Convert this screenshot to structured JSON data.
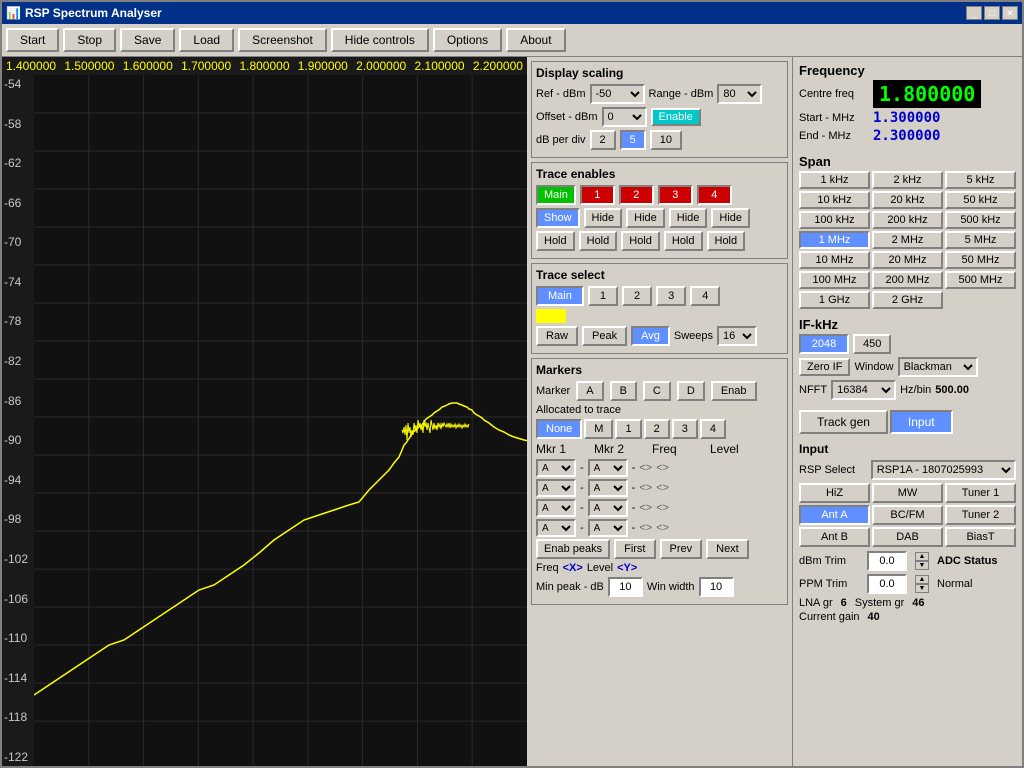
{
  "window": {
    "title": "RSP Spectrum Analyser"
  },
  "titlebar_buttons": [
    "_",
    "□",
    "✕"
  ],
  "toolbar": {
    "start": "Start",
    "stop": "Stop",
    "save": "Save",
    "load": "Load",
    "screenshot": "Screenshot",
    "hide_controls": "Hide controls",
    "options": "Options",
    "about": "About"
  },
  "plot": {
    "freq_labels": [
      "1.400000",
      "1.500000",
      "1.600000",
      "1.700000",
      "1.800000",
      "1.900000",
      "2.000000",
      "2.100000",
      "2.200000"
    ],
    "db_labels": [
      "-54",
      "-58",
      "-62",
      "-66",
      "-70",
      "-74",
      "-78",
      "-82",
      "-86",
      "-90",
      "-94",
      "-98",
      "-102",
      "-106",
      "-110",
      "-114",
      "-118",
      "-122"
    ]
  },
  "display_scaling": {
    "title": "Display scaling",
    "ref_label": "Ref - dBm",
    "ref_value": "-50",
    "range_label": "Range - dBm",
    "range_value": "80",
    "offset_label": "Offset - dBm",
    "offset_value": "0",
    "enable": "Enable",
    "db_per_div_label": "dB per div",
    "db_options": [
      "2",
      "5",
      "10"
    ],
    "db_active": "5"
  },
  "trace_enables": {
    "title": "Trace enables",
    "traces": [
      "Main",
      "1",
      "2",
      "3",
      "4"
    ],
    "show_hide": [
      "Show",
      "Hide",
      "Hide",
      "Hide",
      "Hide"
    ],
    "holds": [
      "Hold",
      "Hold",
      "Hold",
      "Hold",
      "Hold"
    ]
  },
  "trace_select": {
    "title": "Trace select",
    "options": [
      "Main",
      "1",
      "2",
      "3",
      "4"
    ],
    "mode_buttons": [
      "Raw",
      "Peak",
      "Avg"
    ],
    "active_mode": "Avg",
    "sweeps_label": "Sweeps",
    "sweeps_value": "16"
  },
  "markers": {
    "title": "Markers",
    "marker_label": "Marker",
    "letters": [
      "A",
      "B",
      "C",
      "D"
    ],
    "enab": "Enab",
    "allocated_label": "Allocated to trace",
    "alloc_options": [
      "None",
      "M",
      "1",
      "2",
      "3",
      "4"
    ],
    "mkr_labels": [
      "Mkr 1",
      "Mkr 2",
      "Freq",
      "Level"
    ],
    "enab_peaks": "Enab peaks",
    "first": "First",
    "prev": "Prev",
    "next": "Next",
    "freq_label": "Freq",
    "freq_arrow_left": "<X>",
    "level_label": "Level",
    "level_arrow": "<Y>",
    "minpeak_label": "Min peak - dB",
    "minpeak_value": "10",
    "winwidth_label": "Win width",
    "winwidth_value": "10"
  },
  "frequency": {
    "title": "Frequency",
    "centre_label": "Centre freq",
    "centre_value": "1.800000",
    "start_label": "Start - MHz",
    "start_value": "1.300000",
    "end_label": "End - MHz",
    "end_value": "2.300000",
    "span_title": "Span",
    "span_buttons": [
      "1 kHz",
      "2 kHz",
      "5 kHz",
      "10 kHz",
      "20 kHz",
      "50 kHz",
      "100 kHz",
      "200 kHz",
      "500 kHz",
      "1 MHz",
      "2 MHz",
      "5 MHz",
      "10 MHz",
      "20 MHz",
      "50 MHz",
      "100 MHz",
      "200 MHz",
      "500 MHz",
      "1 GHz",
      "2 GHz"
    ],
    "active_span": "1 MHz"
  },
  "if_khz": {
    "title": "IF-kHz",
    "value1": "2048",
    "value2": "450",
    "zero_if": "Zero IF",
    "window_label": "Window",
    "window_value": "Blackman",
    "nfft_label": "NFFT",
    "nfft_value": "16384",
    "hz_bin_label": "Hz/bin",
    "hz_bin_value": "500.00"
  },
  "input_panel": {
    "track_gen": "Track gen",
    "input": "Input",
    "input_section_label": "Input",
    "rsp_label": "RSP Select",
    "rsp_value": "RSP1A - 1807025993",
    "ant_buttons": [
      "HiZ",
      "MW",
      "Tuner 1",
      "Ant A",
      "BC/FM",
      "Tuner 2",
      "Ant B",
      "DAB",
      "BiasT"
    ],
    "active_ant": "Ant A",
    "dbm_trim_label": "dBm Trim",
    "dbm_trim_value": "0.0",
    "ppm_trim_label": "PPM Trim",
    "ppm_trim_value": "0.0",
    "adc_status_label": "ADC Status",
    "adc_status_value": "Normal",
    "lna_gr_label": "LNA gr",
    "lna_gr_value": "6",
    "system_gr_label": "System gr",
    "system_gr_value": "46",
    "current_gain_label": "Current gain",
    "current_gain_value": "40"
  }
}
